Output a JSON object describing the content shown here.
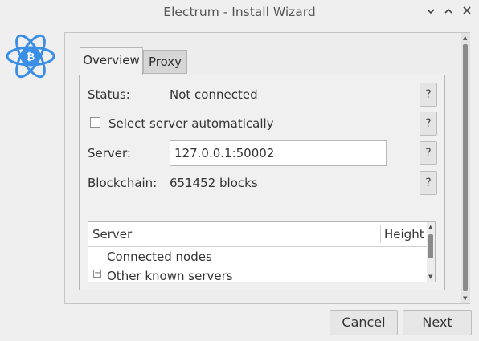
{
  "window": {
    "title": "Electrum  -  Install Wizard",
    "controls": [
      "chevron-down-icon",
      "chevron-up-icon",
      "close-icon"
    ]
  },
  "tabs": [
    {
      "label": "Overview",
      "active": true
    },
    {
      "label": "Proxy",
      "active": false
    }
  ],
  "overview": {
    "status_label": "Status:",
    "status_value": "Not connected",
    "auto_select_label": "Select server automatically",
    "auto_select_checked": false,
    "server_label": "Server:",
    "server_value": "127.0.0.1:50002",
    "blockchain_label": "Blockchain:",
    "blockchain_value": "651452 blocks",
    "help_label": "?"
  },
  "server_tree": {
    "columns": [
      "Server",
      "Height"
    ],
    "rows": [
      "Connected nodes",
      "Other known servers"
    ]
  },
  "buttons": {
    "cancel": "Cancel",
    "next": "Next"
  },
  "colors": {
    "logo_blue": "#3a8ee6",
    "background": "#efefef"
  }
}
